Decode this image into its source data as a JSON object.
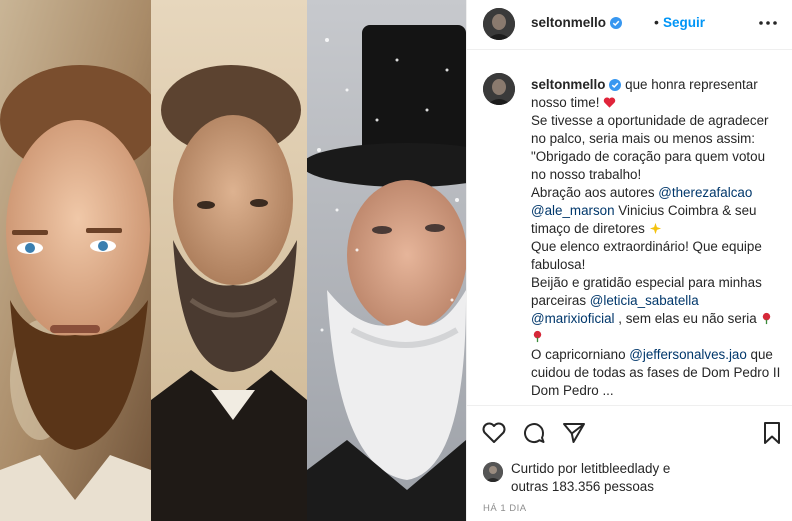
{
  "post": {
    "username": "seltonmello",
    "follow_label": "Seguir",
    "separator": "•"
  },
  "caption": {
    "username": "seltonmello",
    "line1": " que honra representar nosso time!",
    "line2": "Se tivesse a oportunidade de agradecer no palco, seria mais ou menos assim:",
    "line3": "\"Obrigado de coração para quem votou no nosso trabalho!",
    "line4a": "Abração aos autores ",
    "mention1": "@therezafalcao",
    "mention2": "@ale_marson",
    "line4b": " Vinicius Coimbra & seu timaço de diretores",
    "line5": "Que elenco extraordinário! Que equipe fabulosa!",
    "line6": "Beijão e gratidão especial para minhas parceiras ",
    "mention3": "@leticia_sabatella",
    "mention4": "@marixioficial",
    "line6b": " , sem elas eu não seria",
    "line7a": "O capricorniano ",
    "mention5": "@jeffersonalves.jao",
    "line7b": " que cuidou de todas as fases de Dom Pedro II",
    "line8": "Dom Pedro ... "
  },
  "likes": {
    "prefix": "Curtido por ",
    "user": "letitbleedlady",
    "middle": " e ",
    "others": "outras 183.356 pessoas"
  },
  "timestamp": "HÁ 1 DIA",
  "icons": {
    "verified": "verified-badge-icon",
    "more": "more-options-icon",
    "like": "heart-icon",
    "comment": "comment-icon",
    "share": "share-icon",
    "save": "bookmark-icon"
  },
  "colors": {
    "link": "#0095f6",
    "mention": "#00376b",
    "muted": "#8e8e8e",
    "heart": "#ed4956"
  }
}
